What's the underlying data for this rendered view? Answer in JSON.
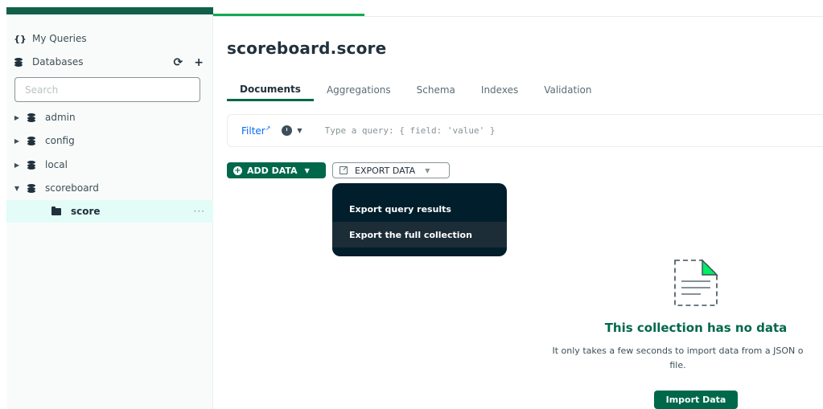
{
  "sidebar": {
    "my_queries_label": "My Queries",
    "databases_label": "Databases",
    "search_placeholder": "Search",
    "databases": [
      {
        "name": "admin",
        "expanded": false
      },
      {
        "name": "config",
        "expanded": false
      },
      {
        "name": "local",
        "expanded": false
      },
      {
        "name": "scoreboard",
        "expanded": true
      }
    ],
    "collections": [
      {
        "name": "score",
        "selected": true
      }
    ]
  },
  "main": {
    "title": "scoreboard.score",
    "tabs": [
      {
        "label": "Documents",
        "active": true
      },
      {
        "label": "Aggregations"
      },
      {
        "label": "Schema"
      },
      {
        "label": "Indexes"
      },
      {
        "label": "Validation"
      }
    ],
    "query": {
      "filter_label": "Filter",
      "placeholder": "Type a query: { field: 'value' }"
    },
    "toolbar": {
      "add_data_label": "ADD DATA",
      "export_data_label": "EXPORT DATA"
    },
    "export_menu": {
      "items": [
        {
          "label": "Export query results"
        },
        {
          "label": "Export the full collection"
        }
      ]
    },
    "empty_state": {
      "title": "This collection has no data",
      "description_line1": "It only takes a few seconds to import data from a JSON o",
      "description_line2": "file.",
      "import_label": "Import Data"
    }
  },
  "colors": {
    "brand_dark_green": "#00684a",
    "brand_green": "#13aa52",
    "menu_bg": "#001e2b",
    "link_blue": "#016bf8",
    "selected_bg": "#e3fcf7"
  }
}
